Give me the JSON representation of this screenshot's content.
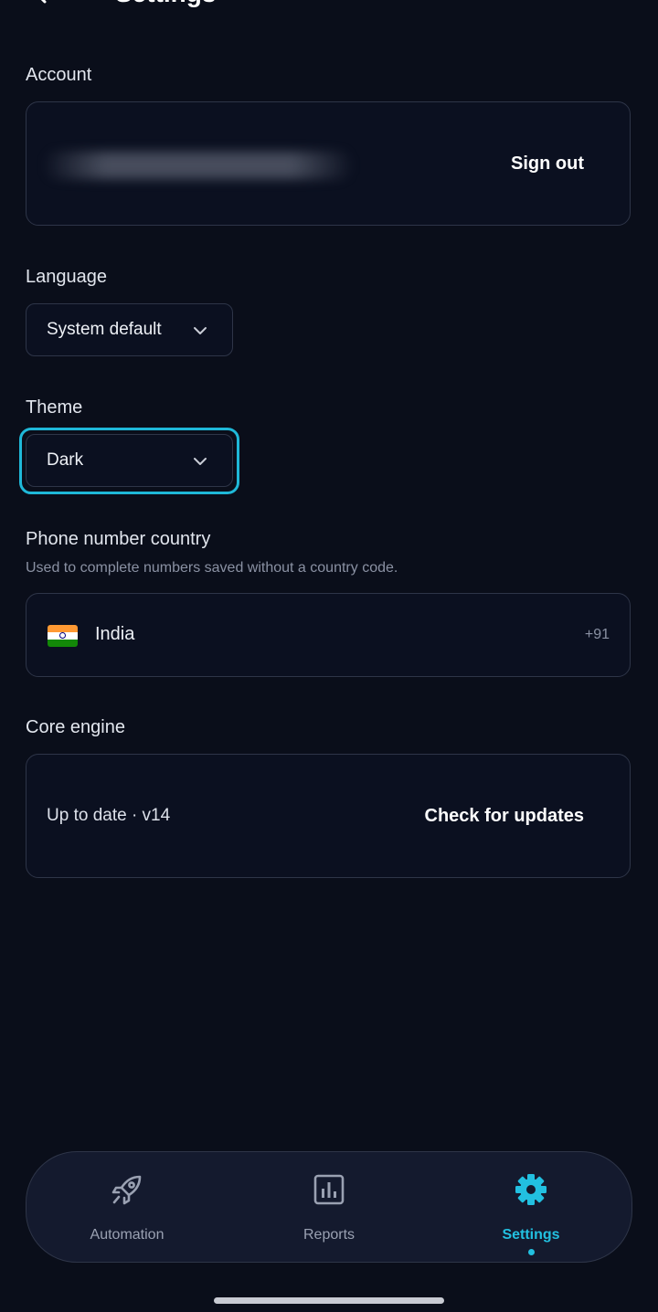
{
  "header": {
    "title": "Settings",
    "back_icon": "chevron-left-icon"
  },
  "account": {
    "label": "Account",
    "sign_out_label": "Sign out"
  },
  "language": {
    "label": "Language",
    "value": "System default"
  },
  "theme": {
    "label": "Theme",
    "value": "Dark"
  },
  "phone_country": {
    "label": "Phone number country",
    "description": "Used to complete numbers saved without a country code.",
    "country": "India",
    "dial_code": "+91",
    "flag_icon": "india-flag-icon"
  },
  "core_engine": {
    "label": "Core engine",
    "status": "Up to date · v14",
    "check_label": "Check for updates"
  },
  "nav": {
    "items": [
      {
        "label": "Automation",
        "icon": "rocket-icon",
        "active": false
      },
      {
        "label": "Reports",
        "icon": "bar-chart-icon",
        "active": false
      },
      {
        "label": "Settings",
        "icon": "gear-icon",
        "active": true
      }
    ]
  },
  "colors": {
    "background": "#0a0e1a",
    "accent": "#22c0e0",
    "border": "#2e3548",
    "nav_background": "#141a2e"
  }
}
